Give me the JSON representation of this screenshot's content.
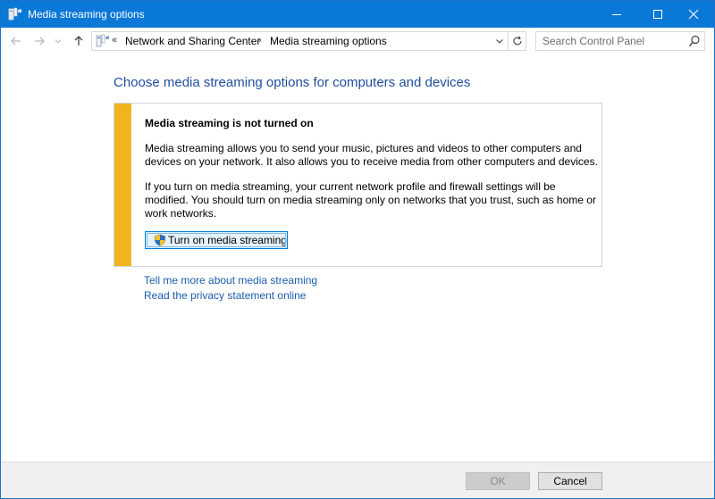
{
  "window": {
    "title": "Media streaming options"
  },
  "nav": {
    "breadcrumb": [
      "Network and Sharing Center",
      "Media streaming options"
    ],
    "crumb_prefix": "«",
    "separator": "›"
  },
  "search": {
    "placeholder": "Search Control Panel"
  },
  "main": {
    "heading": "Choose media streaming options for computers and devices",
    "notice": {
      "title": "Media streaming is not turned on",
      "paragraph1": "Media streaming allows you to send your music, pictures and videos to other computers and devices on your network.  It also allows you to receive media from other computers and devices.",
      "paragraph2": "If you turn on media streaming, your current network profile and firewall settings will be modified. You should turn on media streaming only on networks that you trust, such as home or work networks.",
      "button_label": "Turn on media streaming"
    },
    "links": [
      "Tell me more about media streaming",
      "Read the privacy statement online"
    ]
  },
  "footer": {
    "ok_label": "OK",
    "cancel_label": "Cancel"
  },
  "colors": {
    "titlebar": "#0a78d7",
    "heading": "#1f4e9c",
    "link": "#1a5dab",
    "warning_bar": "#f0b51e"
  },
  "icons": {
    "app": "network-media-icon",
    "minimize": "minimize-icon",
    "maximize": "maximize-icon",
    "close": "close-icon",
    "back": "arrow-left-icon",
    "forward": "arrow-right-icon",
    "recent": "chevron-down-icon",
    "up": "arrow-up-icon",
    "location": "network-location-icon",
    "refresh": "refresh-icon",
    "search": "search-icon",
    "shield": "uac-shield-icon"
  }
}
